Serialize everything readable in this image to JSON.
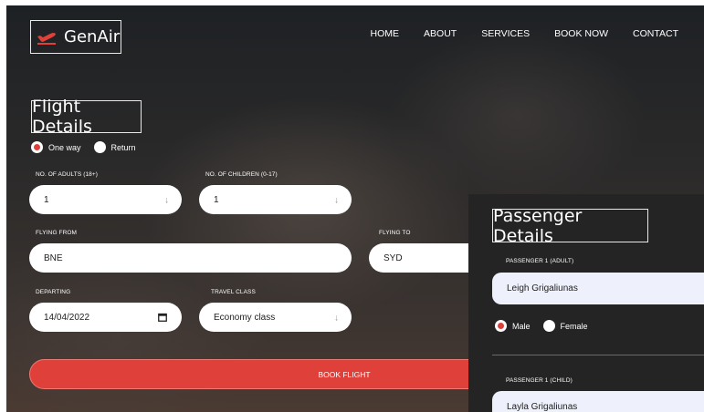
{
  "brand": {
    "name": "GenAir",
    "icon": "airplane-takeoff-icon",
    "accent": "#e0403a"
  },
  "nav": [
    "HOME",
    "ABOUT",
    "SERVICES",
    "BOOK NOW",
    "CONTACT"
  ],
  "flight": {
    "title": "Flight Details",
    "trip_type": {
      "options": [
        "One way",
        "Return"
      ],
      "selected": "One way"
    },
    "adults": {
      "label": "NO. OF ADULTS (18+)",
      "value": "1"
    },
    "children": {
      "label": "NO. OF CHILDREN (0-17)",
      "value": "1"
    },
    "from": {
      "label": "FLYING FROM",
      "value": "BNE"
    },
    "to": {
      "label": "FLYING TO",
      "value": "SYD"
    },
    "departing": {
      "label": "DEPARTING",
      "value": "14/04/2022"
    },
    "travel_class": {
      "label": "TRAVEL CLASS",
      "value": "Economy class"
    },
    "book_label": "BOOK FLIGHT"
  },
  "passengers": {
    "title": "Passenger Details",
    "adult": {
      "label": "PASSENGER 1 (ADULT)",
      "value": "Leigh Grigaliunas"
    },
    "gender": {
      "options": [
        "Male",
        "Female"
      ],
      "selected": "Male"
    },
    "child": {
      "label": "PASSENGER 1 (CHILD)",
      "value": "Layla Grigaliunas"
    }
  }
}
